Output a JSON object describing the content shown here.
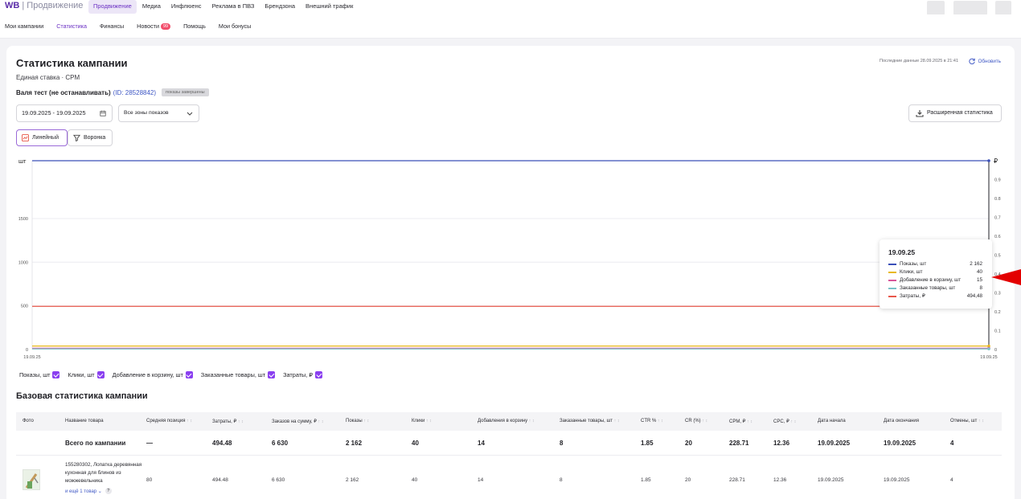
{
  "header": {
    "logo_brand": "WB",
    "logo_product": " | Продвижение",
    "nav": [
      {
        "label": "Продвижение",
        "active": true
      },
      {
        "label": "Медиа",
        "active": false
      },
      {
        "label": "Инфлюенс",
        "active": false
      },
      {
        "label": "Реклама в ПВЗ",
        "active": false
      },
      {
        "label": "Брендзона",
        "active": false
      },
      {
        "label": "Внешний трафик",
        "active": false
      }
    ]
  },
  "subnav": {
    "items": [
      {
        "label": "Мои кампании"
      },
      {
        "label": "Статистика",
        "active": true
      },
      {
        "label": "Финансы"
      },
      {
        "label": "Новости",
        "badge": "99"
      },
      {
        "label": "Помощь"
      },
      {
        "label": "Мои бонусы"
      }
    ]
  },
  "page": {
    "title": "Статистика кампании",
    "subtitle": "Единая ставка · CPM",
    "campaign_name": "Валя тест (не останавливать)",
    "campaign_id": "(ID: 28528842)",
    "campaign_status": "показы завершены",
    "last_data": "Последние данные 28.09.2025 в 21:41",
    "refresh_label": "Обновить"
  },
  "filters": {
    "date_range": "19.09.2025 - 19.09.2025",
    "zones": "Все зоны показов",
    "extended_stats": "Расширенная статистика",
    "view_line": "Линейный",
    "view_funnel": "Воронка"
  },
  "colors": {
    "impressions": "#3a4fb8",
    "clicks": "#e8b81a",
    "cart": "#d8569a",
    "ordered": "#7ac2c9",
    "spend": "#e8574a",
    "accent": "#8a3ff0"
  },
  "chart_data": {
    "type": "line",
    "x": [
      "19.09.25"
    ],
    "x_tick_labels": [
      "19.09.25",
      "19.09.25"
    ],
    "left_axis_label": "шт",
    "right_axis_label": "₽",
    "left_ticks": [
      "0",
      "500",
      "1000",
      "1500"
    ],
    "right_ticks": [
      "0",
      "0.1",
      "0.2",
      "0.3",
      "0.4",
      "0.5",
      "0.6",
      "0.7",
      "0.8",
      "0.9"
    ],
    "series": [
      {
        "name": "Показы, шт",
        "values": [
          2162
        ],
        "axis": "left"
      },
      {
        "name": "Клики, шт",
        "values": [
          40
        ],
        "axis": "left"
      },
      {
        "name": "Добавление в корзину, шт",
        "values": [
          15
        ],
        "axis": "left"
      },
      {
        "name": "Заказанные товары, шт",
        "values": [
          8
        ],
        "axis": "left"
      },
      {
        "name": "Затраты, ₽",
        "values": [
          494.48
        ],
        "axis": "left"
      }
    ],
    "grid": true,
    "tooltip": {
      "date": "19.09.25",
      "rows": [
        {
          "label": "Показы, шт",
          "value": "2 162"
        },
        {
          "label": "Клики, шт",
          "value": "40"
        },
        {
          "label": "Добавление в корзину, шт",
          "value": "15"
        },
        {
          "label": "Заказанные товары, шт",
          "value": "8"
        },
        {
          "label": "Затраты, ₽",
          "value": "494,48"
        }
      ]
    }
  },
  "legend": [
    {
      "label": "Показы, шт"
    },
    {
      "label": "Клики, шт"
    },
    {
      "label": "Добавление в корзину, шт"
    },
    {
      "label": "Заказанные товары, шт"
    },
    {
      "label": "Затраты, ₽"
    }
  ],
  "table": {
    "title": "Базовая статистика кампании",
    "columns": [
      "Фото",
      "Название товара",
      "Средняя позиция",
      "Затраты, ₽",
      "Заказов на сумму, ₽",
      "Показы",
      "Клики",
      "Добавления в корзину",
      "Заказанные товары, шт",
      "CTR %",
      "CR (%)",
      "CPM, ₽",
      "CPC, ₽",
      "Дата начала",
      "Дата окончания",
      "Отмены, шт"
    ],
    "total": [
      "",
      "Всего по кампании",
      "—",
      "494.48",
      "6 630",
      "2 162",
      "40",
      "14",
      "8",
      "1.85",
      "20",
      "228.71",
      "12.36",
      "19.09.2025",
      "19.09.2025",
      "4"
    ],
    "row": {
      "product_name": "155280302, Лопатка деревянная кухонная для блинов из можжевельника",
      "more": "и ещё 1 товар ⌄",
      "cells": [
        "80",
        "494.48",
        "6 630",
        "2 162",
        "40",
        "14",
        "8",
        "1.85",
        "20",
        "228.71",
        "12.36",
        "19.09.2025",
        "19.09.2025",
        "4"
      ]
    }
  }
}
